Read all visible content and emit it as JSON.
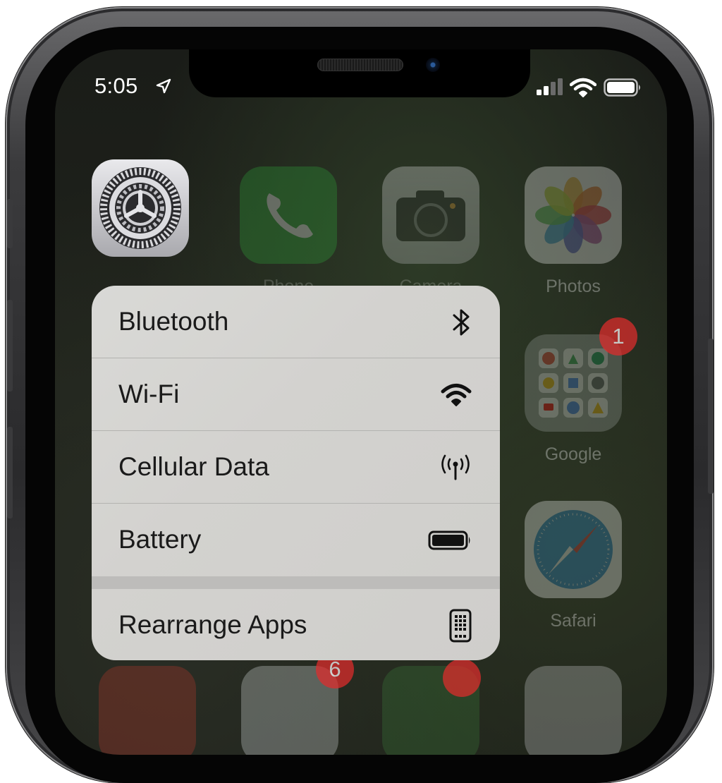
{
  "status_bar": {
    "time": "5:05",
    "icons": [
      "location-arrow-icon",
      "signal-icon",
      "wifi-icon",
      "battery-icon"
    ]
  },
  "home_screen": {
    "apps": [
      {
        "name": "Settings",
        "label": "",
        "icon": "settings-gear-icon"
      },
      {
        "name": "Phone",
        "label": "Phone",
        "icon": "phone-icon"
      },
      {
        "name": "Camera",
        "label": "Camera",
        "icon": "camera-icon"
      },
      {
        "name": "Photos",
        "label": "Photos",
        "icon": "photos-icon"
      },
      {
        "name": "Google",
        "label": "Google",
        "icon": "google-folder-icon",
        "badge": "1"
      },
      {
        "name": "Safari",
        "label": "Safari",
        "icon": "safari-compass-icon"
      }
    ],
    "bottom_badge": "6"
  },
  "context_menu": {
    "items": [
      {
        "label": "Bluetooth",
        "icon": "bluetooth-icon"
      },
      {
        "label": "Wi-Fi",
        "icon": "wifi-icon"
      },
      {
        "label": "Cellular Data",
        "icon": "cellular-antenna-icon"
      },
      {
        "label": "Battery",
        "icon": "battery-icon"
      }
    ],
    "footer_item": {
      "label": "Rearrange Apps",
      "icon": "rearrange-apps-icon"
    }
  },
  "colors": {
    "menu_background": "#d3d2cf",
    "badge_red": "#e12c2c",
    "phone_green": "#2fa93a",
    "safari_blue": "#2a8fd6"
  }
}
